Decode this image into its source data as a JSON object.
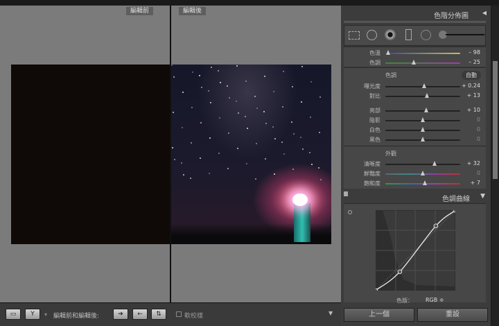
{
  "view": {
    "before_label": "編輯前",
    "after_label": "編輯後"
  },
  "toolbar": {
    "compare_label": "編輯前和編輯後:",
    "softproof_label": "軟校樣"
  },
  "panel": {
    "histogram_title": "色階分佈圖",
    "wb": [
      {
        "label": "色溫",
        "value": "– 98",
        "pos": 0.04,
        "track": "linear-gradient(90deg,#3a4aa0,#c8c050)"
      },
      {
        "label": "色調",
        "value": "– 25",
        "pos": 0.38,
        "track": "linear-gradient(90deg,#3a8a3a,#a040a0)"
      }
    ],
    "tone_title": "色調",
    "auto_label": "自動",
    "tone": [
      {
        "label": "曝光度",
        "value": "+ 0.24",
        "pos": 0.52
      },
      {
        "label": "對比",
        "value": "+ 13",
        "pos": 0.56
      }
    ],
    "tone2": [
      {
        "label": "亮部",
        "value": "+ 10",
        "pos": 0.55
      },
      {
        "label": "陰影",
        "value": "0",
        "pos": 0.5
      },
      {
        "label": "白色",
        "value": "0",
        "pos": 0.5
      },
      {
        "label": "黑色",
        "value": "0",
        "pos": 0.5
      }
    ],
    "presence_title": "外觀",
    "presence": [
      {
        "label": "清晰度",
        "value": "+ 32",
        "pos": 0.66
      },
      {
        "label": "鮮豔度",
        "value": "0",
        "pos": 0.5,
        "track": "linear-gradient(90deg,#666,#3a8a8a,#8a40a0,#c03030)"
      },
      {
        "label": "飽和度",
        "value": "+ 7",
        "pos": 0.53,
        "track": "linear-gradient(90deg,#3a9a3a,#3a6aa0,#a040a0,#c03030)"
      }
    ],
    "curve_title": "色調曲線",
    "curve_points": [
      [
        0,
        0
      ],
      [
        0.3,
        0.23
      ],
      [
        0.76,
        0.81
      ],
      [
        1,
        1
      ]
    ],
    "channel_label": "色版：",
    "channel_value": "RGB ≑",
    "prev_button": "上一個",
    "reset_button": "重設"
  }
}
